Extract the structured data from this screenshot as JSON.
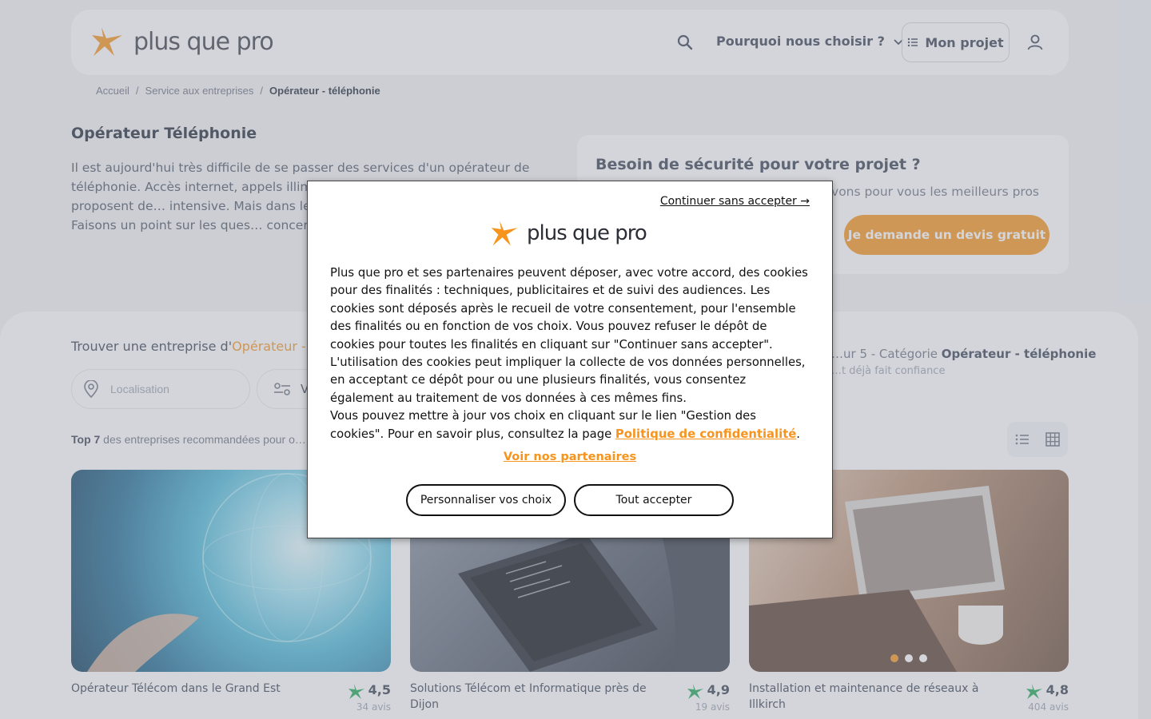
{
  "brand": {
    "name": "plus que pro",
    "accent": "#f7941d"
  },
  "nav": {
    "why_label": "Pourquoi nous choisir ?",
    "project_label": "Mon projet",
    "icons": [
      "search-icon",
      "chevron-down-icon",
      "list-icon",
      "user-icon"
    ]
  },
  "breadcrumb": [
    "Accueil",
    "/",
    "Service aux entreprises",
    "/",
    "Opérateur - téléphonie"
  ],
  "hero": {
    "title": "Opérateur Téléphonie",
    "description": "Il est aujourd'hui très difficile de se passer des services d'un opérateur de téléphonie. Accès internet, appels illim… accès à la télévision, tous proposent de… intensive. Mais dans le panel d'offres p… retrouver. Faisons un point sur les ques… concernant la thématique de la télépho…"
  },
  "security_card": {
    "title": "Besoin de sécurité pour votre projet ?",
    "subtitle": "…uvons pour vous les meilleurs pros",
    "cta": "Je demande un devis gratuit"
  },
  "search": {
    "title_prefix": "Trouver une entreprise d'",
    "title_highlight": "Opérateur - t…",
    "location_placeholder": "Localisation",
    "filter_label": "V…"
  },
  "results": {
    "top_bold": "Top 7",
    "top_rest": " des entreprises recommandées pour o…",
    "rating_prefix": "…ur 5 - Catégorie ",
    "rating_category": "Opérateur - téléphonie",
    "rating_sub": "…t déjà fait confiance"
  },
  "cards": [
    {
      "title": "Opérateur Télécom dans le Grand Est",
      "score": "4,5",
      "reviews": "34 avis"
    },
    {
      "title": "Solutions Télécom et Informatique près de Dijon",
      "score": "4,9",
      "reviews": "19 avis"
    },
    {
      "title": "Installation et maintenance de réseaux à Illkirch",
      "score": "4,8",
      "reviews": "404 avis"
    }
  ],
  "cookie_modal": {
    "skip_label": "Continuer sans accepter →",
    "body_text": "Plus que pro et ses partenaires peuvent déposer, avec votre accord, des cookies pour des finalités : techniques, publicitaires et de suivi des audiences. Les cookies sont déposés après le recueil de votre consentement, pour l'ensemble des finalités ou en fonction de vos choix. Vous pouvez refuser le dépôt de cookies pour toutes les finalités en cliquant sur \"Continuer sans accepter\". L'utilisation des cookies peut impliquer la collecte de vos données personnelles, en acceptant ce dépôt pour ou une plusieurs finalités, vous consentez également au traitement de vos données à ces mêmes fins.",
    "body_text_2": "Vous pouvez mettre à jour vos choix en cliquant sur le lien \"Gestion des cookies\". Pour en savoir plus, consultez la page ",
    "privacy_link": "Politique de confidentialité",
    "period": ".",
    "partners_link": "Voir nos partenaires",
    "customize_button": "Personnaliser vos choix",
    "accept_button": "Tout accepter"
  }
}
